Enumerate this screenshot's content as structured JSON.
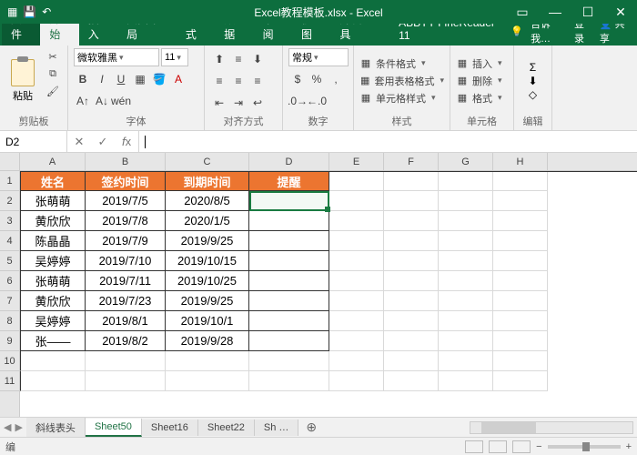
{
  "window": {
    "title": "Excel教程模板.xlsx - Excel"
  },
  "menu": {
    "file": "文件",
    "home": "开始",
    "insert": "插入",
    "layout": "页面布局",
    "formula": "公式",
    "data": "数据",
    "review": "审阅",
    "view": "视图",
    "dev": "开发工具",
    "abbyy": "ABBYY FineReader 11",
    "tellme": "告诉我…",
    "login": "登录",
    "share": "共享"
  },
  "ribbon": {
    "clipboard": {
      "paste": "粘贴",
      "label": "剪贴板"
    },
    "font": {
      "name": "微软雅黑",
      "size": "11",
      "label": "字体"
    },
    "align": {
      "label": "对齐方式",
      "general": "常规"
    },
    "number": {
      "label": "数字"
    },
    "styles": {
      "cond": "条件格式",
      "table": "套用表格格式",
      "cell": "单元格样式",
      "label": "样式"
    },
    "cells": {
      "insert": "插入",
      "delete": "删除",
      "format": "格式",
      "label": "单元格"
    },
    "editing": {
      "label": "编辑"
    }
  },
  "namebox": "D2",
  "columns": [
    "A",
    "B",
    "C",
    "D",
    "E",
    "F",
    "G",
    "H"
  ],
  "rows": [
    "1",
    "2",
    "3",
    "4",
    "5",
    "6",
    "7",
    "8",
    "9",
    "10",
    "11"
  ],
  "table": {
    "headers": [
      "姓名",
      "签约时间",
      "到期时间",
      "提醒"
    ],
    "data": [
      [
        "张萌萌",
        "2019/7/5",
        "2020/8/5",
        ""
      ],
      [
        "黄欣欣",
        "2019/7/8",
        "2020/1/5",
        ""
      ],
      [
        "陈晶晶",
        "2019/7/9",
        "2019/9/25",
        ""
      ],
      [
        "吴婷婷",
        "2019/7/10",
        "2019/10/15",
        ""
      ],
      [
        "张萌萌",
        "2019/7/11",
        "2019/10/25",
        ""
      ],
      [
        "黄欣欣",
        "2019/7/23",
        "2019/9/25",
        ""
      ],
      [
        "吴婷婷",
        "2019/8/1",
        "2019/10/1",
        ""
      ],
      [
        "张——",
        "2019/8/2",
        "2019/9/28",
        ""
      ]
    ]
  },
  "sheets": {
    "s1": "斜线表头",
    "s2": "Sheet50",
    "s3": "Sheet16",
    "s4": "Sheet22",
    "s5": "Sh …"
  },
  "status": {
    "mode": "编"
  }
}
